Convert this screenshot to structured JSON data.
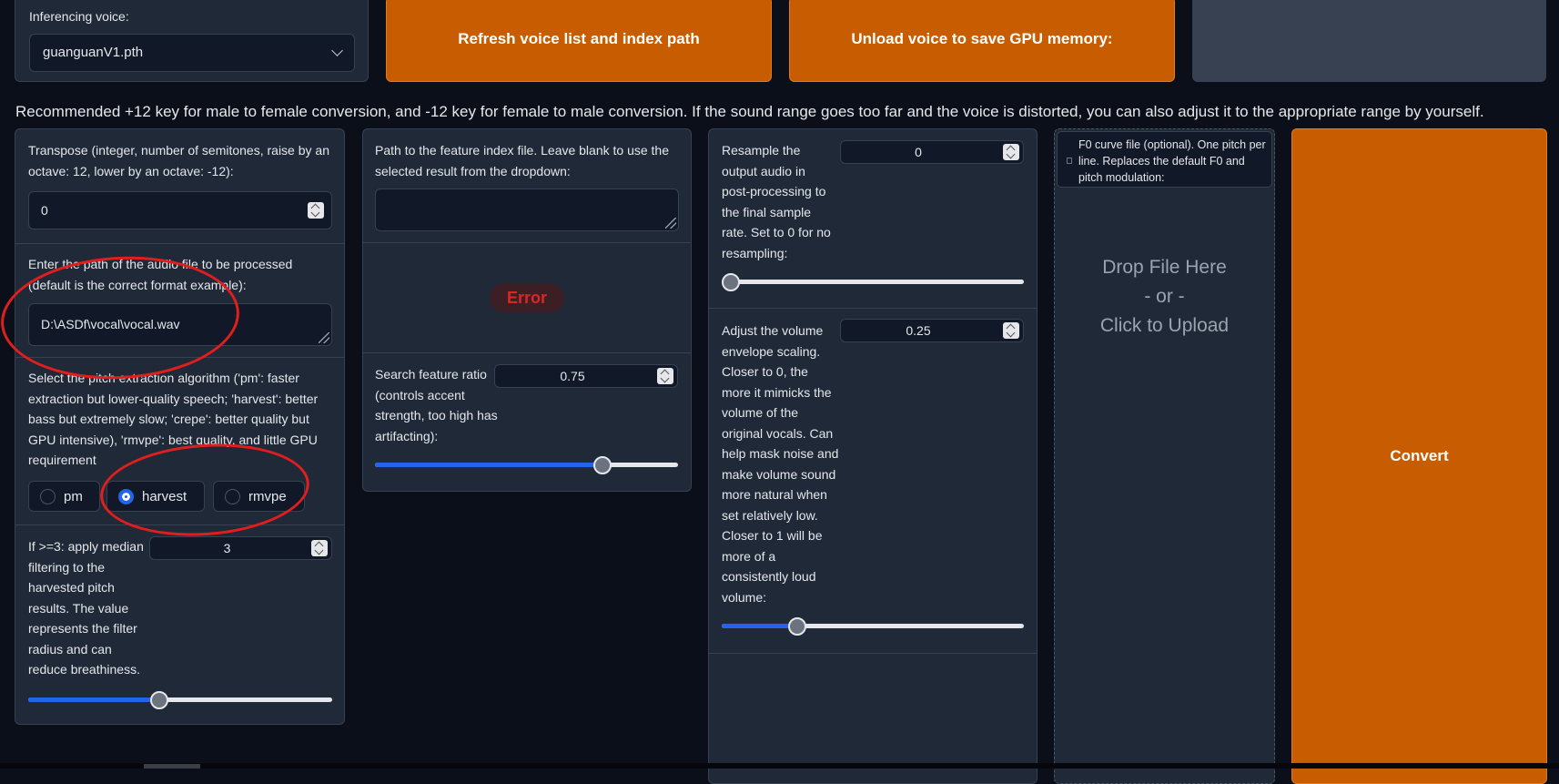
{
  "voice": {
    "label": "Inferencing voice:",
    "selected": "guanguanV1.pth"
  },
  "buttons": {
    "refresh": "Refresh voice list and index path",
    "unload": "Unload voice to save GPU memory:",
    "convert": "Convert"
  },
  "hint": "Recommended +12 key for male to female conversion, and -12 key for female to male conversion. If the sound range goes too far and the voice is distorted, you can also adjust it to the appropriate range by yourself.",
  "transpose": {
    "label": "Transpose (integer, number of semitones, raise by an octave: 12, lower by an octave: -12):",
    "value": "0"
  },
  "audio_path": {
    "label": "Enter the path of the audio file to be processed (default is the correct format example):",
    "value": "D:\\ASDf\\vocal\\vocal.wav"
  },
  "pitch": {
    "label": "Select the pitch extraction algorithm ('pm': faster extraction but lower-quality speech; 'harvest': better bass but extremely slow; 'crepe': better quality but GPU intensive), 'rmvpe': best quality, and little GPU requirement",
    "options": [
      "pm",
      "harvest",
      "rmvpe"
    ],
    "selected": "harvest"
  },
  "median": {
    "label": "If >=3: apply median filtering to the harvested pitch results. The value represents the filter radius and can reduce breathiness.",
    "value": "3",
    "fraction": 0.43
  },
  "index_path": {
    "label": "Path to the feature index file. Leave blank to use the selected result from the dropdown:",
    "value": ""
  },
  "error_badge": "Error",
  "feature_ratio": {
    "label": "Search feature ratio (controls accent strength, too high has artifacting):",
    "value": "0.75",
    "fraction": 0.75
  },
  "resample": {
    "label": "Resample the output audio in post-processing to the final sample rate. Set to 0 for no resampling:",
    "value": "0",
    "fraction": 0.0
  },
  "volume": {
    "label": "Adjust the volume envelope scaling. Closer to 0, the more it mimicks the volume of the original vocals. Can help mask noise and make volume sound more natural when set relatively low. Closer to 1 will be more of a consistently loud volume:",
    "value": "0.25",
    "fraction": 0.25
  },
  "f0_file": {
    "label": "F0 curve file (optional). One pitch per line. Replaces the default F0 and pitch modulation:",
    "drop_line1": "Drop File Here",
    "drop_line2": "- or -",
    "drop_line3": "Click to Upload"
  },
  "colors": {
    "background": "#0b0f19",
    "panel": "#1f2937",
    "accent_orange": "#c75d00",
    "slider_blue": "#2563eb",
    "annotation_red": "#e01e1e"
  }
}
